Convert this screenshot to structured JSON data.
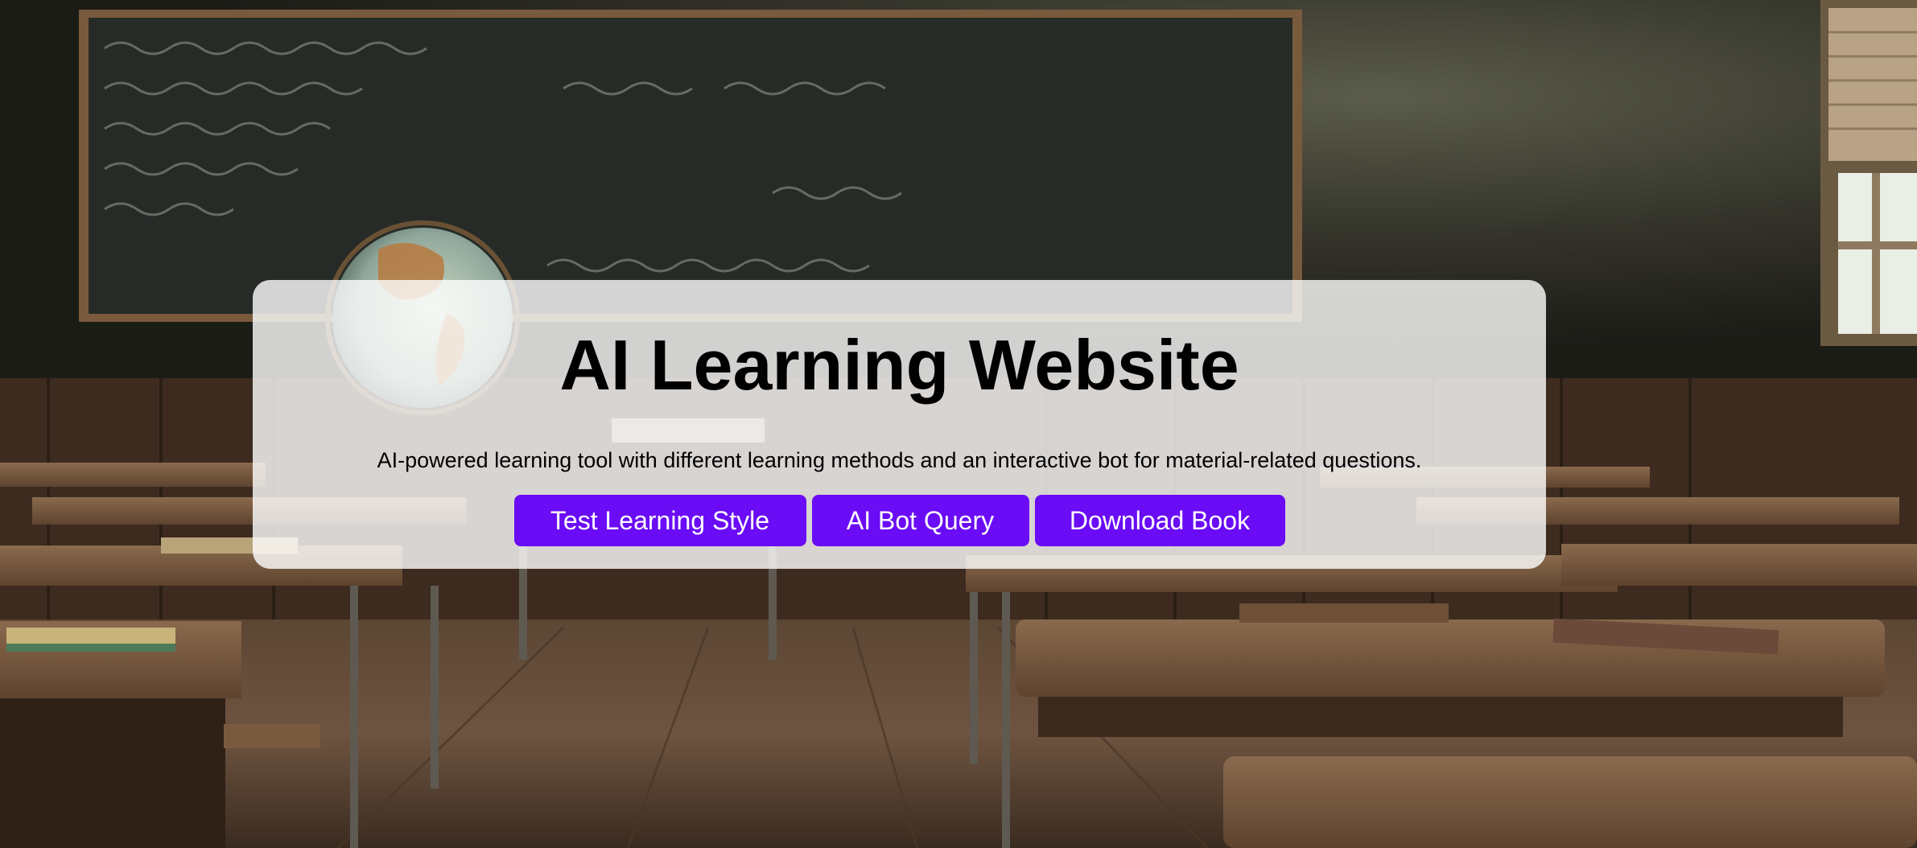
{
  "hero": {
    "title": "AI Learning Website",
    "subtitle": "AI-powered learning tool with different learning methods and an interactive bot for material-related questions.",
    "buttons": [
      {
        "label": "Test Learning Style"
      },
      {
        "label": "AI Bot Query"
      },
      {
        "label": "Download Book"
      }
    ]
  },
  "background": {
    "scene": "classroom-photo",
    "icons": [
      "globe-icon",
      "chalkboard-icon",
      "desk-icon",
      "window-icon"
    ]
  },
  "colors": {
    "button_bg": "#6a0cf5",
    "button_text": "#ffffff",
    "card_bg": "rgba(255,255,255,0.80)",
    "title_text": "#000000"
  }
}
